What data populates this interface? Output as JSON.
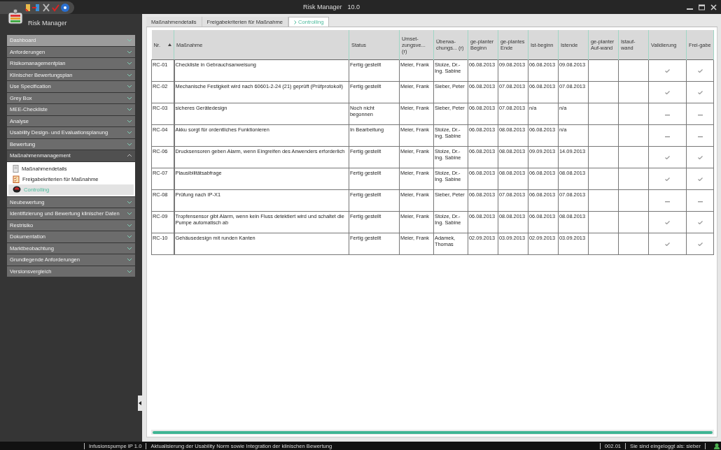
{
  "window": {
    "title": "Risk Manager",
    "version": "10.0"
  },
  "app_name": "Risk Manager",
  "sidebar": {
    "items": [
      {
        "label": "Dashboard",
        "hovered": true,
        "expanded": false
      },
      {
        "label": "Anforderungen",
        "hovered": false,
        "expanded": false
      },
      {
        "label": "Risikomanagementplan",
        "hovered": false,
        "expanded": false
      },
      {
        "label": "Klinischer Bewertungsplan",
        "hovered": false,
        "expanded": false
      },
      {
        "label": "Use Specification",
        "hovered": false,
        "expanded": false
      },
      {
        "label": "Grey Box",
        "hovered": false,
        "expanded": false
      },
      {
        "label": "MEE-Checkliste",
        "hovered": false,
        "expanded": false
      },
      {
        "label": "Analyse",
        "hovered": false,
        "expanded": false
      },
      {
        "label": "Usability Design- und Evaluationsplanung",
        "hovered": false,
        "expanded": false
      },
      {
        "label": "Bewertung",
        "hovered": false,
        "expanded": false
      },
      {
        "label": "Maßnahmenmanagement",
        "hovered": false,
        "expanded": true,
        "children": [
          {
            "label": "Maßnahmendetails",
            "kind": "document",
            "selected": false
          },
          {
            "label": "Freigabekriterien für Maßnahme",
            "kind": "checklist",
            "selected": false
          },
          {
            "label": "Controlling",
            "kind": "gauge",
            "selected": true
          }
        ]
      },
      {
        "label": "Neubewertung",
        "hovered": false,
        "expanded": false
      },
      {
        "label": "Identifizierung und Bewertung klinischer Daten",
        "hovered": false,
        "expanded": false
      },
      {
        "label": "Restrisiko",
        "hovered": false,
        "expanded": false
      },
      {
        "label": "Dokumentation",
        "hovered": false,
        "expanded": false
      },
      {
        "label": "Marktbeobachtung",
        "hovered": false,
        "expanded": false
      },
      {
        "label": "Grundlegende Anforderungen",
        "hovered": false,
        "expanded": false
      },
      {
        "label": "Versionsvergleich",
        "hovered": false,
        "expanded": false
      }
    ]
  },
  "tabs": [
    {
      "label": "Maßnahmendetails",
      "selected": false
    },
    {
      "label": "Freigabekriterien für Maßnahme",
      "selected": false
    },
    {
      "label": "Controlling",
      "selected": true
    }
  ],
  "table": {
    "columns": [
      {
        "label": "Nr.",
        "sorted": true
      },
      {
        "label": "Maßnahme",
        "sorted": false
      },
      {
        "label": "Status",
        "sorted": false
      },
      {
        "label": "Umset-zungsve... (r)",
        "sorted": false
      },
      {
        "label": "Überwa-chungs... (r)",
        "sorted": false
      },
      {
        "label": "ge-planter Beginn",
        "sorted": false
      },
      {
        "label": "ge-plantes Ende",
        "sorted": false
      },
      {
        "label": "Ist-beginn",
        "sorted": false
      },
      {
        "label": "Istende",
        "sorted": false
      },
      {
        "label": "ge-planter Auf-wand",
        "sorted": false
      },
      {
        "label": "Istauf-wand",
        "sorted": false
      },
      {
        "label": "Validierung",
        "sorted": false
      },
      {
        "label": "Frei-gabe",
        "sorted": false
      }
    ],
    "rows": [
      {
        "nr": "RC-01",
        "measure": "Checkliste in Gebrauchsanweisung",
        "status": "Fertig gestellt",
        "implementer": "Meier, Frank",
        "monitor": "Stolze, Dr.-Ing. Sabine",
        "planned_start": "06.08.2013",
        "planned_end": "09.08.2013",
        "actual_start": "06.08.2013",
        "actual_end": "09.08.2013",
        "validated": true,
        "released": true
      },
      {
        "nr": "RC-02",
        "measure": "Mechanische Festigkeit wird nach 60601-2-24 (21) geprüft (Prüfprotokoll)",
        "status": "Fertig gestellt",
        "implementer": "Meier, Frank",
        "monitor": "Sieber, Peter",
        "planned_start": "06.08.2013",
        "planned_end": "07.08.2013",
        "actual_start": "06.08.2013",
        "actual_end": "07.08.2013",
        "validated": true,
        "released": true
      },
      {
        "nr": "RC-03",
        "measure": "sicheres Gerätedesign",
        "status": "Noch nicht begonnen",
        "implementer": "Meier, Frank",
        "monitor": "Sieber, Peter",
        "planned_start": "06.08.2013",
        "planned_end": "07.08.2013",
        "actual_start": "n/a",
        "actual_end": "n/a",
        "validated": false,
        "released": false
      },
      {
        "nr": "RC-04",
        "measure": "Akku sorgt für ordentliches Funktionieren",
        "status": "In Bearbeitung",
        "implementer": "Meier, Frank",
        "monitor": "Stolze, Dr.-Ing. Sabine",
        "planned_start": "06.08.2013",
        "planned_end": "08.08.2013",
        "actual_start": "06.08.2013",
        "actual_end": "n/a",
        "validated": false,
        "released": false
      },
      {
        "nr": "RC-06",
        "measure": "Drucksensoren geben Alarm, wenn Eingreifen des Anwenders erforderlich",
        "status": "Fertig gestellt",
        "implementer": "Meier, Frank",
        "monitor": "Stolze, Dr.-Ing. Sabine",
        "planned_start": "06.08.2013",
        "planned_end": "08.08.2013",
        "actual_start": "09.09.2013",
        "actual_end": "14.09.2013",
        "validated": true,
        "released": true
      },
      {
        "nr": "RC-07",
        "measure": "Plausibilitätsabfrage",
        "status": "Fertig gestellt",
        "implementer": "Meier, Frank",
        "monitor": "Stolze, Dr.-Ing. Sabine",
        "planned_start": "06.08.2013",
        "planned_end": "08.08.2013",
        "actual_start": "06.08.2013",
        "actual_end": "08.08.2013",
        "validated": true,
        "released": true
      },
      {
        "nr": "RC-08",
        "measure": "Prüfung nach IP-X1",
        "status": "Fertig gestellt",
        "implementer": "Meier, Frank",
        "monitor": "Sieber, Peter",
        "planned_start": "06.08.2013",
        "planned_end": "07.08.2013",
        "actual_start": "06.08.2013",
        "actual_end": "07.08.2013",
        "validated": false,
        "released": false
      },
      {
        "nr": "RC-09",
        "measure": "Tropfensensor gibt Alarm, wenn kein Fluss detektiert wird und schaltet die Pumpe automatisch ab",
        "status": "Fertig gestellt",
        "implementer": "Meier, Frank",
        "monitor": "Stolze, Dr.-Ing. Sabine",
        "planned_start": "06.08.2013",
        "planned_end": "08.08.2013",
        "actual_start": "06.08.2013",
        "actual_end": "08.08.2013",
        "validated": true,
        "released": true
      },
      {
        "nr": "RC-10",
        "measure": "Gehäusedesign mit runden Kanten",
        "status": "Fertig gestellt",
        "implementer": "Meier, Frank",
        "monitor": "Adamek, Thomas",
        "planned_start": "02.09.2013",
        "planned_end": "03.09.2013",
        "actual_start": "02.09.2013",
        "actual_end": "03.09.2013",
        "validated": true,
        "released": true
      }
    ]
  },
  "status_bar": {
    "project": "Infusionspumpe IP 1.0",
    "description": "Aktualisierung der Usability Norm sowie Integration der klinischen Bewertung",
    "version": "002.01",
    "login": "Sie sind eingeloggt als: sieber"
  }
}
